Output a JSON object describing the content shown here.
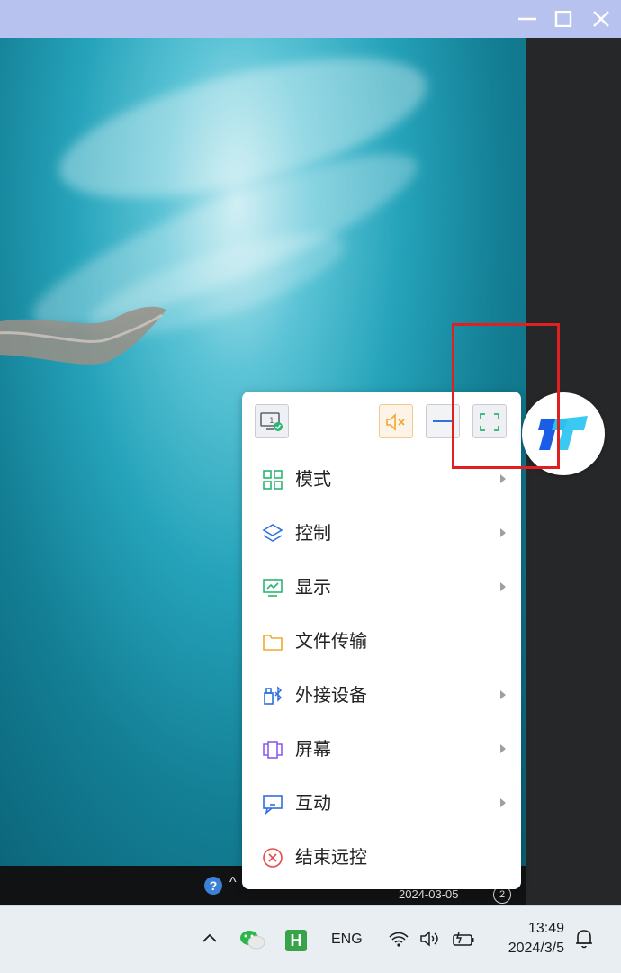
{
  "window": {
    "minimize_label": "—",
    "maximize_label": "□",
    "close_label": "✕"
  },
  "remote_taskbar": {
    "help_label": "?",
    "date": "2024-03-05",
    "badge": "2"
  },
  "toolbar": {
    "screen_number": "1",
    "icons": [
      "monitor-check-icon",
      "mute-icon",
      "minimize-icon",
      "fullscreen-icon"
    ]
  },
  "menu": {
    "items": [
      {
        "label": "模式",
        "icon": "grid-icon",
        "has_submenu": true,
        "color": "#2bb673"
      },
      {
        "label": "控制",
        "icon": "layers-icon",
        "has_submenu": true,
        "color": "#2f6fde"
      },
      {
        "label": "显示",
        "icon": "chart-monitor-icon",
        "has_submenu": true,
        "color": "#2bb673"
      },
      {
        "label": "文件传输",
        "icon": "folder-icon",
        "has_submenu": false,
        "color": "#f0a830"
      },
      {
        "label": "外接设备",
        "icon": "usb-bluetooth-icon",
        "has_submenu": true,
        "color": "#2f6fde"
      },
      {
        "label": "屏幕",
        "icon": "screens-icon",
        "has_submenu": true,
        "color": "#8a5cf0"
      },
      {
        "label": "互动",
        "icon": "chat-screen-icon",
        "has_submenu": true,
        "color": "#2f6fde"
      },
      {
        "label": "结束远控",
        "icon": "close-circle-icon",
        "has_submenu": false,
        "color": "#e84a4a"
      }
    ]
  },
  "taskbar": {
    "language": "ENG",
    "h_app_label": "H",
    "time": "13:49",
    "date": "2024/3/5"
  },
  "colors": {
    "highlight": "#e11f1f",
    "titlebar": "#b8c2ee",
    "accent_green": "#2bb673"
  }
}
